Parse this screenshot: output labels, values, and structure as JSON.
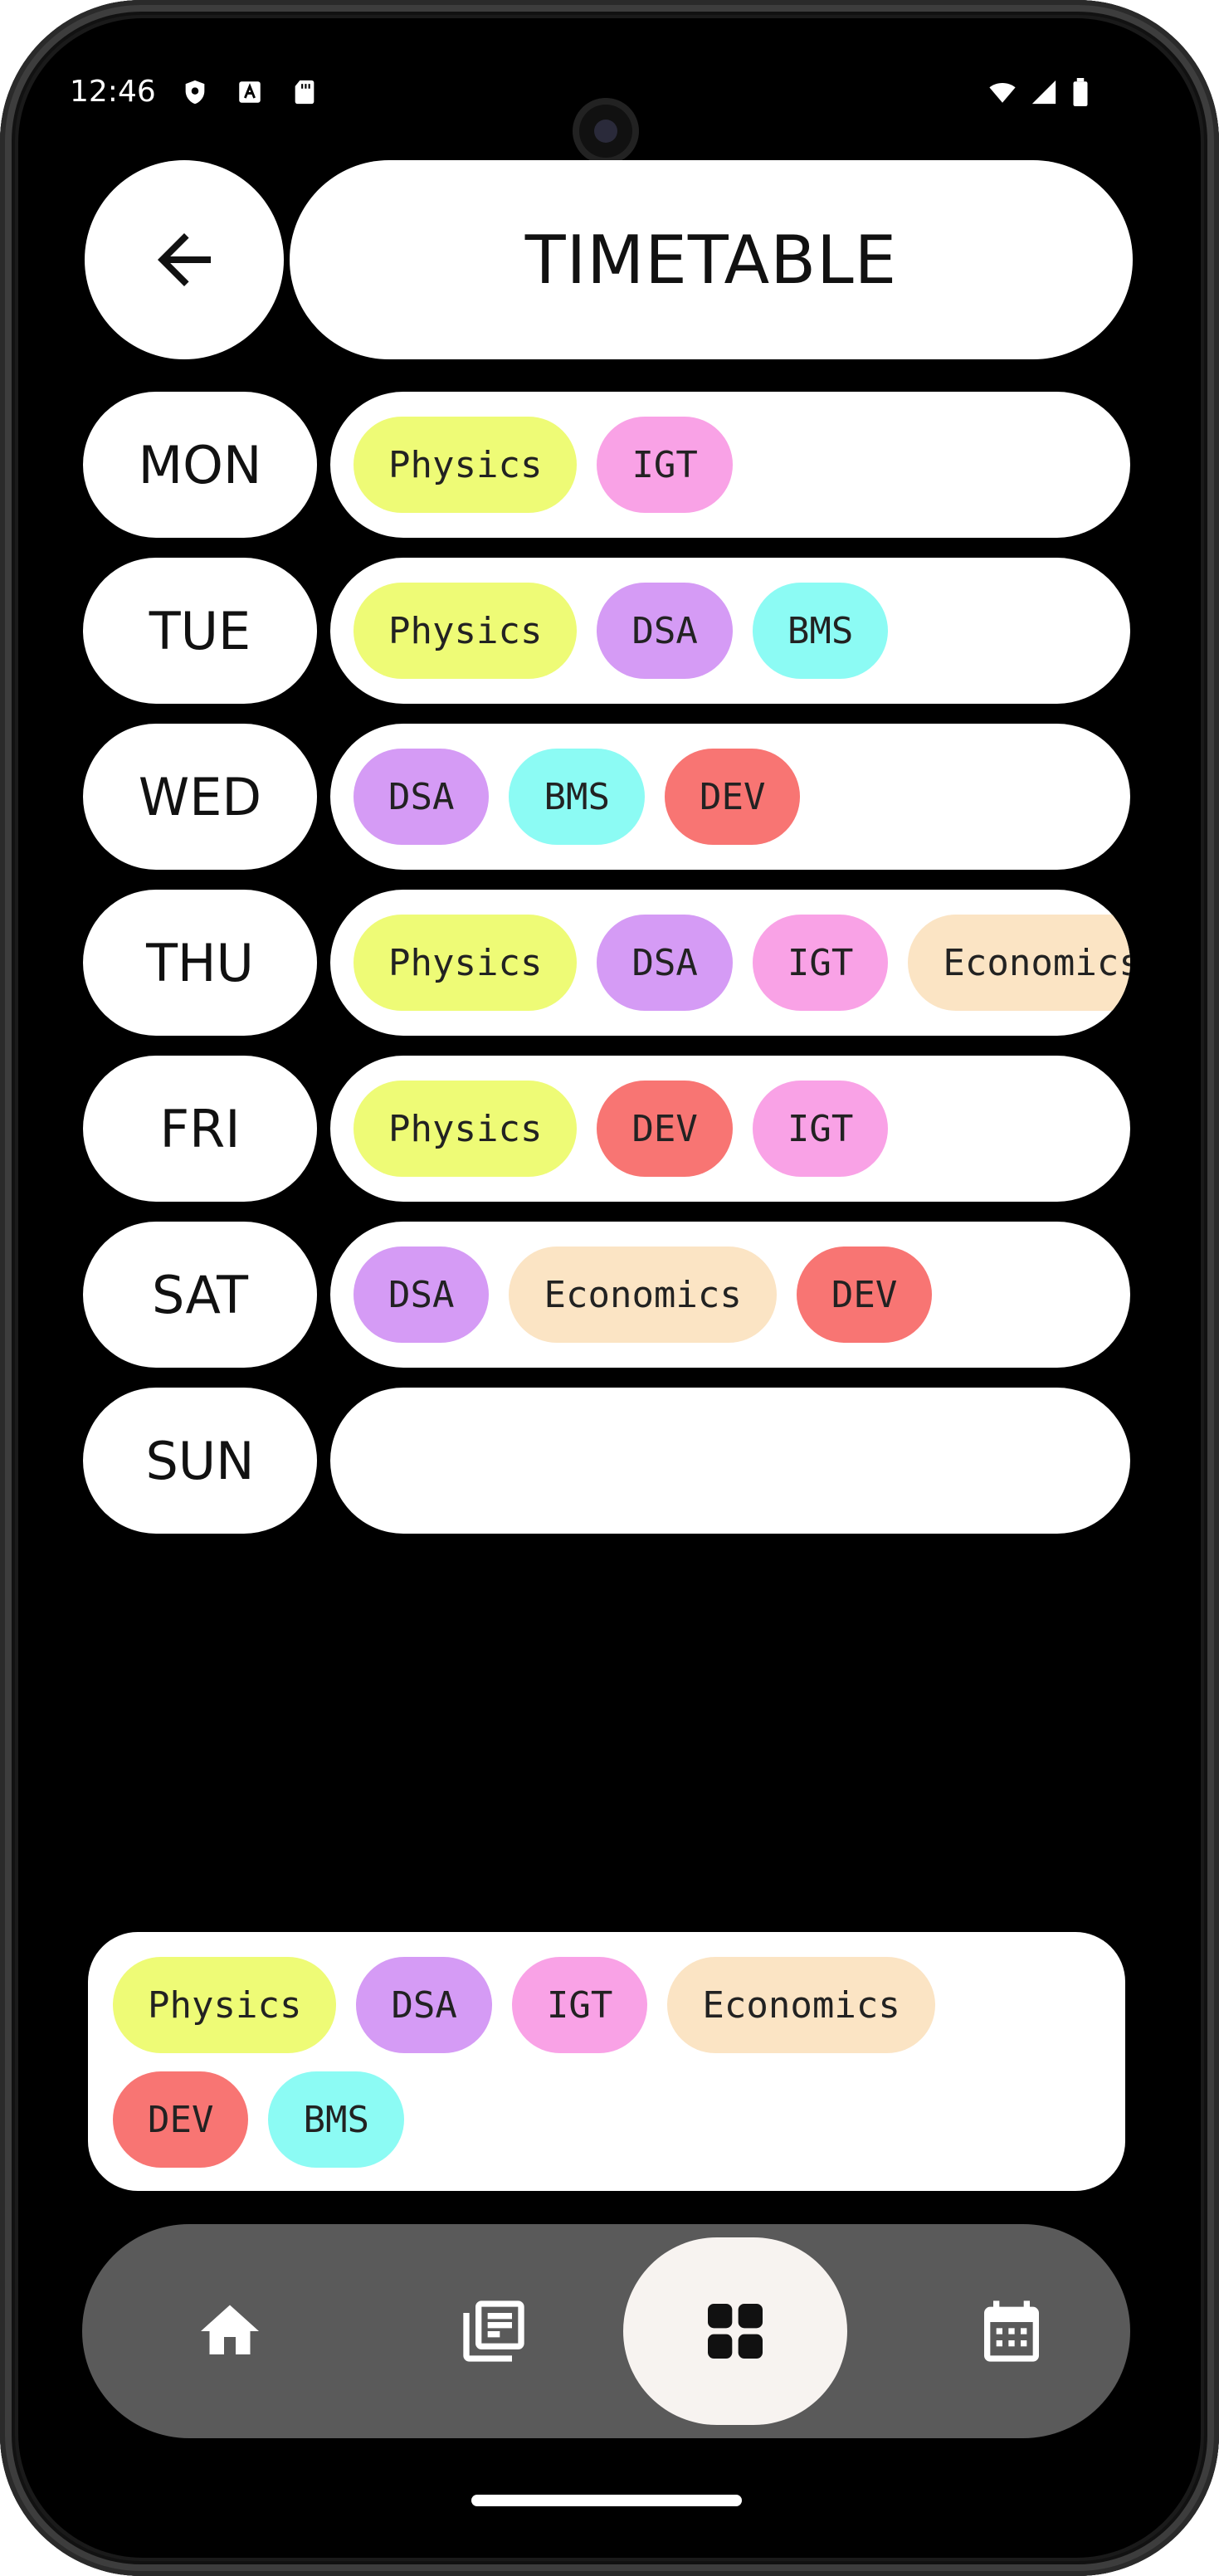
{
  "status_bar": {
    "time": "12:46",
    "icons": [
      "shield-icon",
      "a-box-icon",
      "sd-card-icon",
      "wifi-icon",
      "signal-icon",
      "battery-icon"
    ]
  },
  "header": {
    "back_icon": "arrow-left-icon",
    "title": "TIMETABLE"
  },
  "subjects": {
    "Physics": "#eefb76",
    "DSA": "#d59bf5",
    "IGT": "#f9a2e6",
    "Economics": "#fbe4c4",
    "DEV": "#f87573",
    "BMS": "#8cfbf4"
  },
  "timetable": [
    {
      "day": "MON",
      "subjects": [
        "Physics",
        "IGT"
      ]
    },
    {
      "day": "TUE",
      "subjects": [
        "Physics",
        "DSA",
        "BMS"
      ]
    },
    {
      "day": "WED",
      "subjects": [
        "DSA",
        "BMS",
        "DEV"
      ]
    },
    {
      "day": "THU",
      "subjects": [
        "Physics",
        "DSA",
        "IGT",
        "Economics"
      ]
    },
    {
      "day": "FRI",
      "subjects": [
        "Physics",
        "DEV",
        "IGT"
      ]
    },
    {
      "day": "SAT",
      "subjects": [
        "DSA",
        "Economics",
        "DEV"
      ]
    },
    {
      "day": "SUN",
      "subjects": []
    }
  ],
  "legend": {
    "rows": [
      [
        "Physics",
        "DSA",
        "IGT",
        "Economics"
      ],
      [
        "DEV",
        "BMS"
      ]
    ]
  },
  "bottom_nav": {
    "items": [
      "home-icon",
      "library-books-icon",
      "grid-view-icon",
      "calendar-icon"
    ],
    "active": "grid-view-icon"
  }
}
